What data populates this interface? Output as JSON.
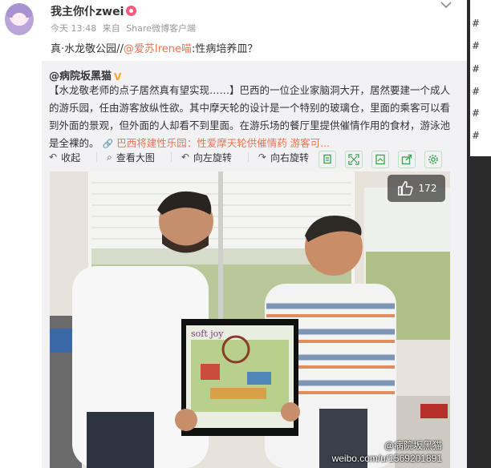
{
  "post": {
    "username": "我主你仆zwei",
    "meta_time": "今天 13:48",
    "meta_from": "来自",
    "meta_client": "Share微博客户端",
    "text_prefix": "真·水龙敬公园//",
    "mention": "@爱苏Irene喵",
    "text_suffix": ":性病培养皿？"
  },
  "repost": {
    "username": "@病院坂黑猫",
    "body": "【水龙敬老师的点子居然真有望实现……】巴西的一位企业家脑洞大开，居然要建一个成人的游乐园，任由游客放纵性欲。其中摩天轮的设计是一个特别的玻璃仓，里面的乘客可以看到外面的景观，但外面的人却看不到里面。在游乐场的餐厅里提供催情作用的食材，游泳池是全裸的。",
    "link_text": "巴西将建性乐园：性爱摩天轮供催情药 游客可..."
  },
  "toolbar": {
    "collect": "收起",
    "view_large": "查看大图",
    "rotate_left": "向左旋转",
    "rotate_right": "向右旋转"
  },
  "photo": {
    "likes": "172",
    "watermark_handle": "@病院坂黑猫",
    "watermark_url": "weibo.com/u/1569201891",
    "poster_title": "soft joy"
  },
  "sidebar": {
    "hash_items": [
      "#",
      "#",
      "#",
      "#",
      "#",
      "#"
    ]
  },
  "colors": {
    "accent": "#eb7350",
    "repost_bg": "#f2f2f5",
    "toolbar_icon": "#3aa04a"
  }
}
